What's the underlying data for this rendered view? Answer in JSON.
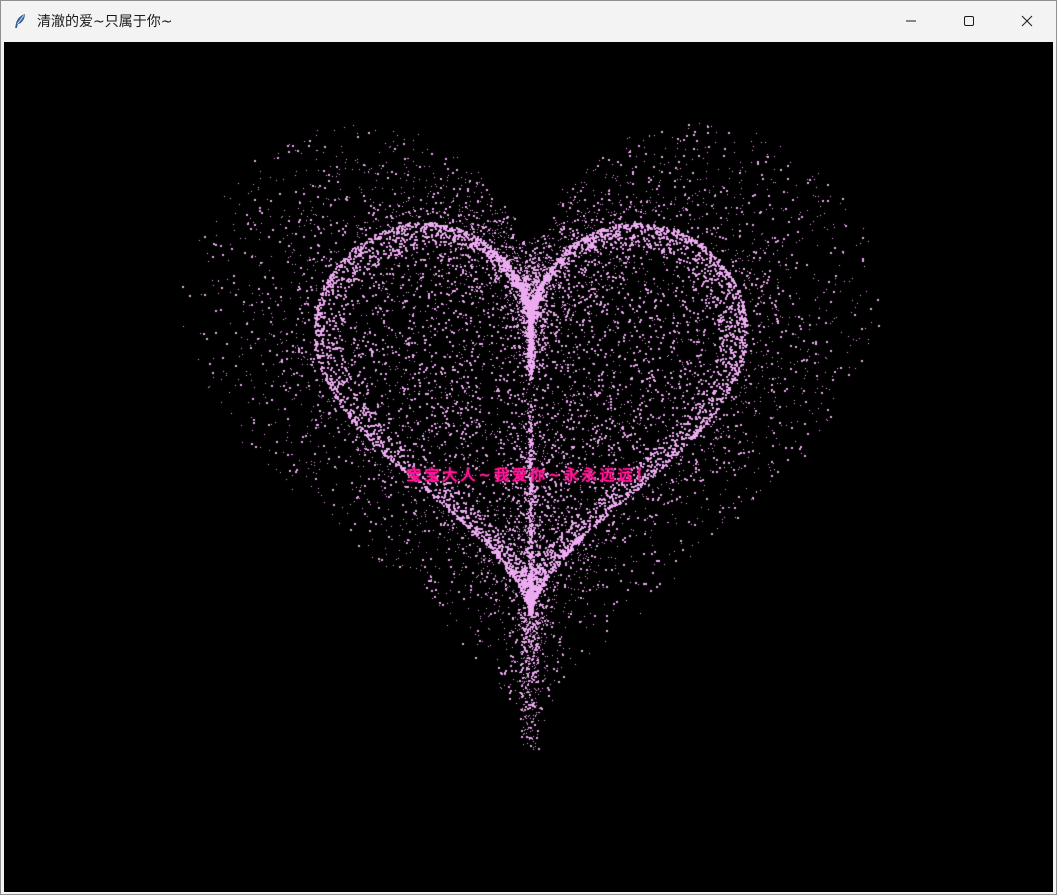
{
  "window": {
    "title": "清澈的爱~只属于你~",
    "icon": "feather-icon"
  },
  "controls": {
    "minimize_icon": "minimize-icon",
    "maximize_icon": "maximize-icon",
    "close_icon": "close-icon"
  },
  "canvas": {
    "background": "#000000",
    "particle_color": "#ecaaf0",
    "text_color": "#ff1493",
    "message": "宝宝大人~我爱你~永永远远！"
  }
}
